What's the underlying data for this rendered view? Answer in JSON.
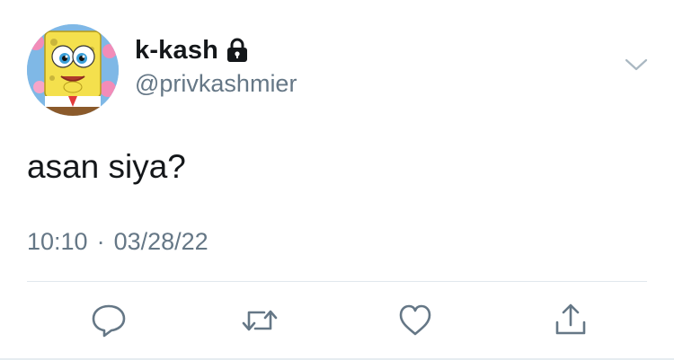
{
  "tweet": {
    "display_name": "k-kash",
    "handle": "@privkashmier",
    "text": "asan siya?",
    "time": "10:10",
    "separator": "·",
    "date": "03/28/22",
    "protected_icon": "lock-icon",
    "avatar_icon": "spongebob-avatar",
    "menu_icon": "chevron-down-icon"
  },
  "actions": [
    {
      "name": "reply",
      "icon": "reply-icon"
    },
    {
      "name": "retweet",
      "icon": "retweet-icon"
    },
    {
      "name": "like",
      "icon": "heart-icon"
    },
    {
      "name": "share",
      "icon": "share-icon"
    }
  ],
  "colors": {
    "text_primary": "#14171a",
    "text_secondary": "#657786",
    "icon_gray": "#657786",
    "divider": "#e1e8ed"
  }
}
